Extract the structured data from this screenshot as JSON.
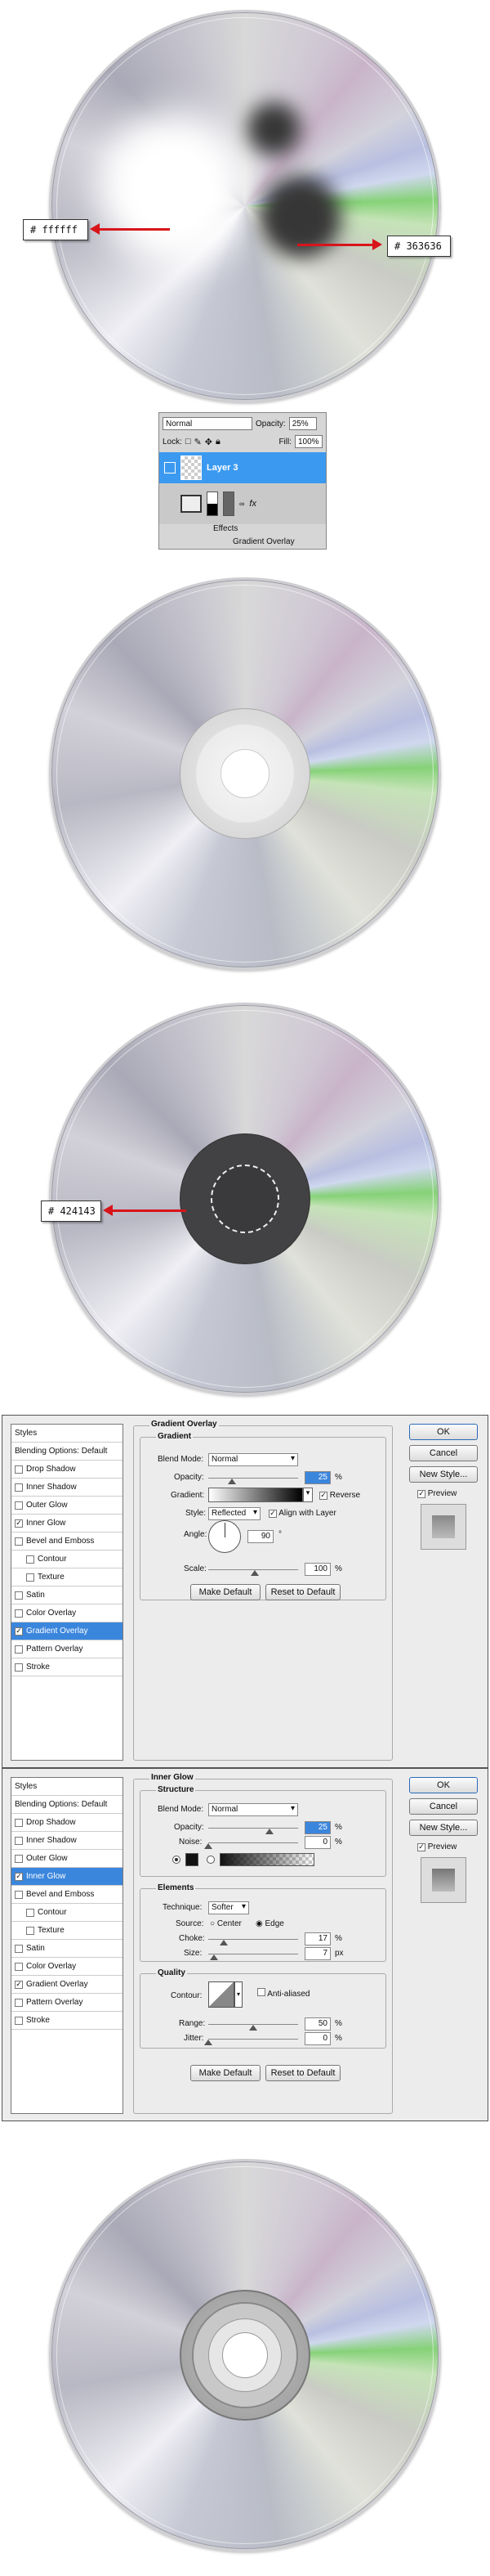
{
  "callouts": {
    "white": "#   ffffff",
    "dark": "#   363636",
    "ring": "#   424143"
  },
  "layers_panel": {
    "blend": "Normal",
    "opacity_label": "Opacity:",
    "opacity": "25%",
    "lock_label": "Lock:",
    "fill_label": "Fill:",
    "fill": "100%",
    "layer_name": "Layer 3",
    "effects": "Effects",
    "gradient_overlay": "Gradient Overlay",
    "fx": "fx"
  },
  "styles_list": [
    "Styles",
    "Blending Options: Default",
    "Drop Shadow",
    "Inner Shadow",
    "Outer Glow",
    "Inner Glow",
    "Bevel and Emboss",
    "Contour",
    "Texture",
    "Satin",
    "Color Overlay",
    "Gradient Overlay",
    "Pattern Overlay",
    "Stroke"
  ],
  "buttons": {
    "ok": "OK",
    "cancel": "Cancel",
    "new_style": "New Style...",
    "preview": "Preview",
    "make_default": "Make Default",
    "reset": "Reset to Default"
  },
  "gradient_overlay": {
    "title": "Gradient Overlay",
    "sub": "Gradient",
    "blend_label": "Blend Mode:",
    "blend": "Normal",
    "opacity_label": "Opacity:",
    "opacity": "25",
    "gradient_label": "Gradient:",
    "reverse": "Reverse",
    "style_label": "Style:",
    "style": "Reflected",
    "align": "Align with Layer",
    "angle_label": "Angle:",
    "angle": "90",
    "scale_label": "Scale:",
    "scale": "100",
    "pct": "%",
    "deg": "°"
  },
  "inner_glow": {
    "title": "Inner Glow",
    "structure": "Structure",
    "blend_label": "Blend Mode:",
    "blend": "Normal",
    "opacity_label": "Opacity:",
    "opacity": "25",
    "noise_label": "Noise:",
    "noise": "0",
    "elements": "Elements",
    "technique_label": "Technique:",
    "technique": "Softer",
    "source_label": "Source:",
    "center": "Center",
    "edge": "Edge",
    "choke_label": "Choke:",
    "choke": "17",
    "size_label": "Size:",
    "size": "7",
    "px": "px",
    "quality": "Quality",
    "contour_label": "Contour:",
    "anti": "Anti-aliased",
    "range_label": "Range:",
    "range": "50",
    "jitter_label": "Jitter:",
    "jitter": "0",
    "pct": "%"
  }
}
